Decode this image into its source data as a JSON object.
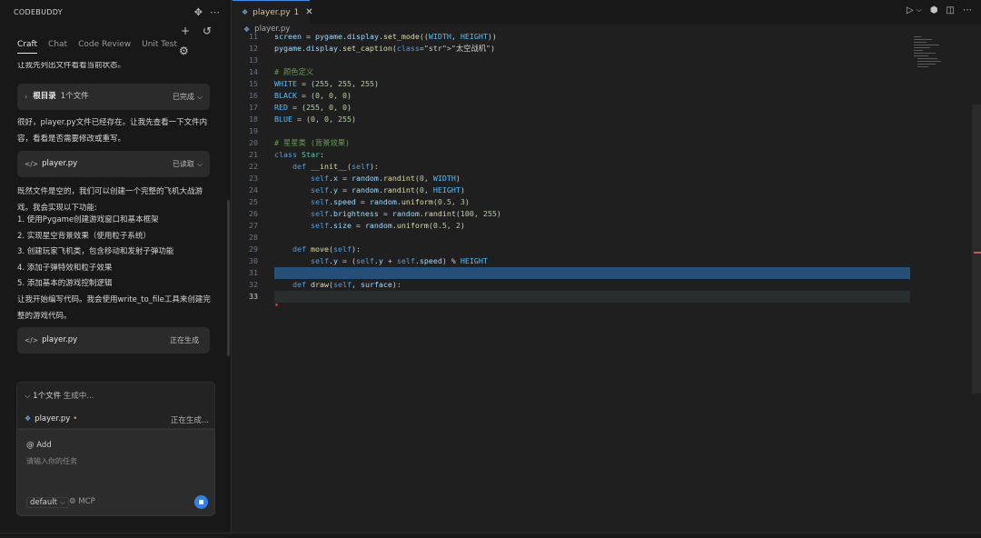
{
  "sidebar": {
    "title": "CODEBUDDY",
    "tabs": [
      {
        "label": "Craft"
      },
      {
        "label": "Chat"
      },
      {
        "label": "Code Review"
      },
      {
        "label": "Unit Test"
      }
    ]
  },
  "chat": {
    "cut_line": "让我先列出文件看看当前状态。",
    "card_dir": {
      "name": "根目录",
      "count": "1个文件",
      "state": "已完成"
    },
    "para1": "很好，player.py文件已经存在。让我先查看一下文件内容，看看是否需要修改或重写。",
    "card_read": {
      "name": "player.py",
      "state": "已读取"
    },
    "para2": "既然文件是空的，我们可以创建一个完整的飞机大战游戏。我会实现以下功能:",
    "steps": [
      "1. 使用Pygame创建游戏窗口和基本框架",
      "2. 实现星空背景效果（使用粒子系统）",
      "3. 创建玩家飞机类，包含移动和发射子弹功能",
      "4. 添加子弹特效和粒子效果",
      "5. 添加基本的游戏控制逻辑"
    ],
    "para3": "让我开始编写代码。我会使用write_to_file工具来创建完整的游戏代码。",
    "card_gen": {
      "name": "player.py",
      "state": "正在生成"
    }
  },
  "generating": {
    "count": "1个文件",
    "status": "生成中...",
    "file": "player.py",
    "file_state": "正在生成..."
  },
  "composer": {
    "add_label": "@ Add",
    "placeholder": "请输入你的任务",
    "model": "default",
    "mcp": "MCP"
  },
  "editor": {
    "tab_name": "player.py",
    "tab_count": "1",
    "breadcrumb": "player.py"
  },
  "code": [
    {
      "n": "11",
      "t": "screen = pygame.display.set_mode((WIDTH, HEIGHT))"
    },
    {
      "n": "12",
      "t": "pygame.display.set_caption(\"太空战机\")"
    },
    {
      "n": "13",
      "t": ""
    },
    {
      "n": "14",
      "t": "# 颜色定义"
    },
    {
      "n": "15",
      "t": "WHITE = (255, 255, 255)"
    },
    {
      "n": "16",
      "t": "BLACK = (0, 0, 0)"
    },
    {
      "n": "17",
      "t": "RED = (255, 0, 0)"
    },
    {
      "n": "18",
      "t": "BLUE = (0, 0, 255)"
    },
    {
      "n": "19",
      "t": ""
    },
    {
      "n": "20",
      "t": "# 星星类 (背景效果)"
    },
    {
      "n": "21",
      "t": "class Star:"
    },
    {
      "n": "22",
      "t": "    def __init__(self):"
    },
    {
      "n": "23",
      "t": "        self.x = random.randint(0, WIDTH)"
    },
    {
      "n": "24",
      "t": "        self.y = random.randint(0, HEIGHT)"
    },
    {
      "n": "25",
      "t": "        self.speed = random.uniform(0.5, 3)"
    },
    {
      "n": "26",
      "t": "        self.brightness = random.randint(100, 255)"
    },
    {
      "n": "27",
      "t": "        self.size = random.uniform(0.5, 2)"
    },
    {
      "n": "28",
      "t": ""
    },
    {
      "n": "29",
      "t": "    def move(self):"
    },
    {
      "n": "30",
      "t": "        self.y = (self.y + self.speed) % HEIGHT"
    },
    {
      "n": "31",
      "t": ""
    },
    {
      "n": "32",
      "t": "    def draw(self, surface):"
    },
    {
      "n": "33",
      "t": ""
    }
  ],
  "colors": {
    "accent": "#2f80ed",
    "modified": "#e2c08d",
    "selection": "#264f78"
  }
}
